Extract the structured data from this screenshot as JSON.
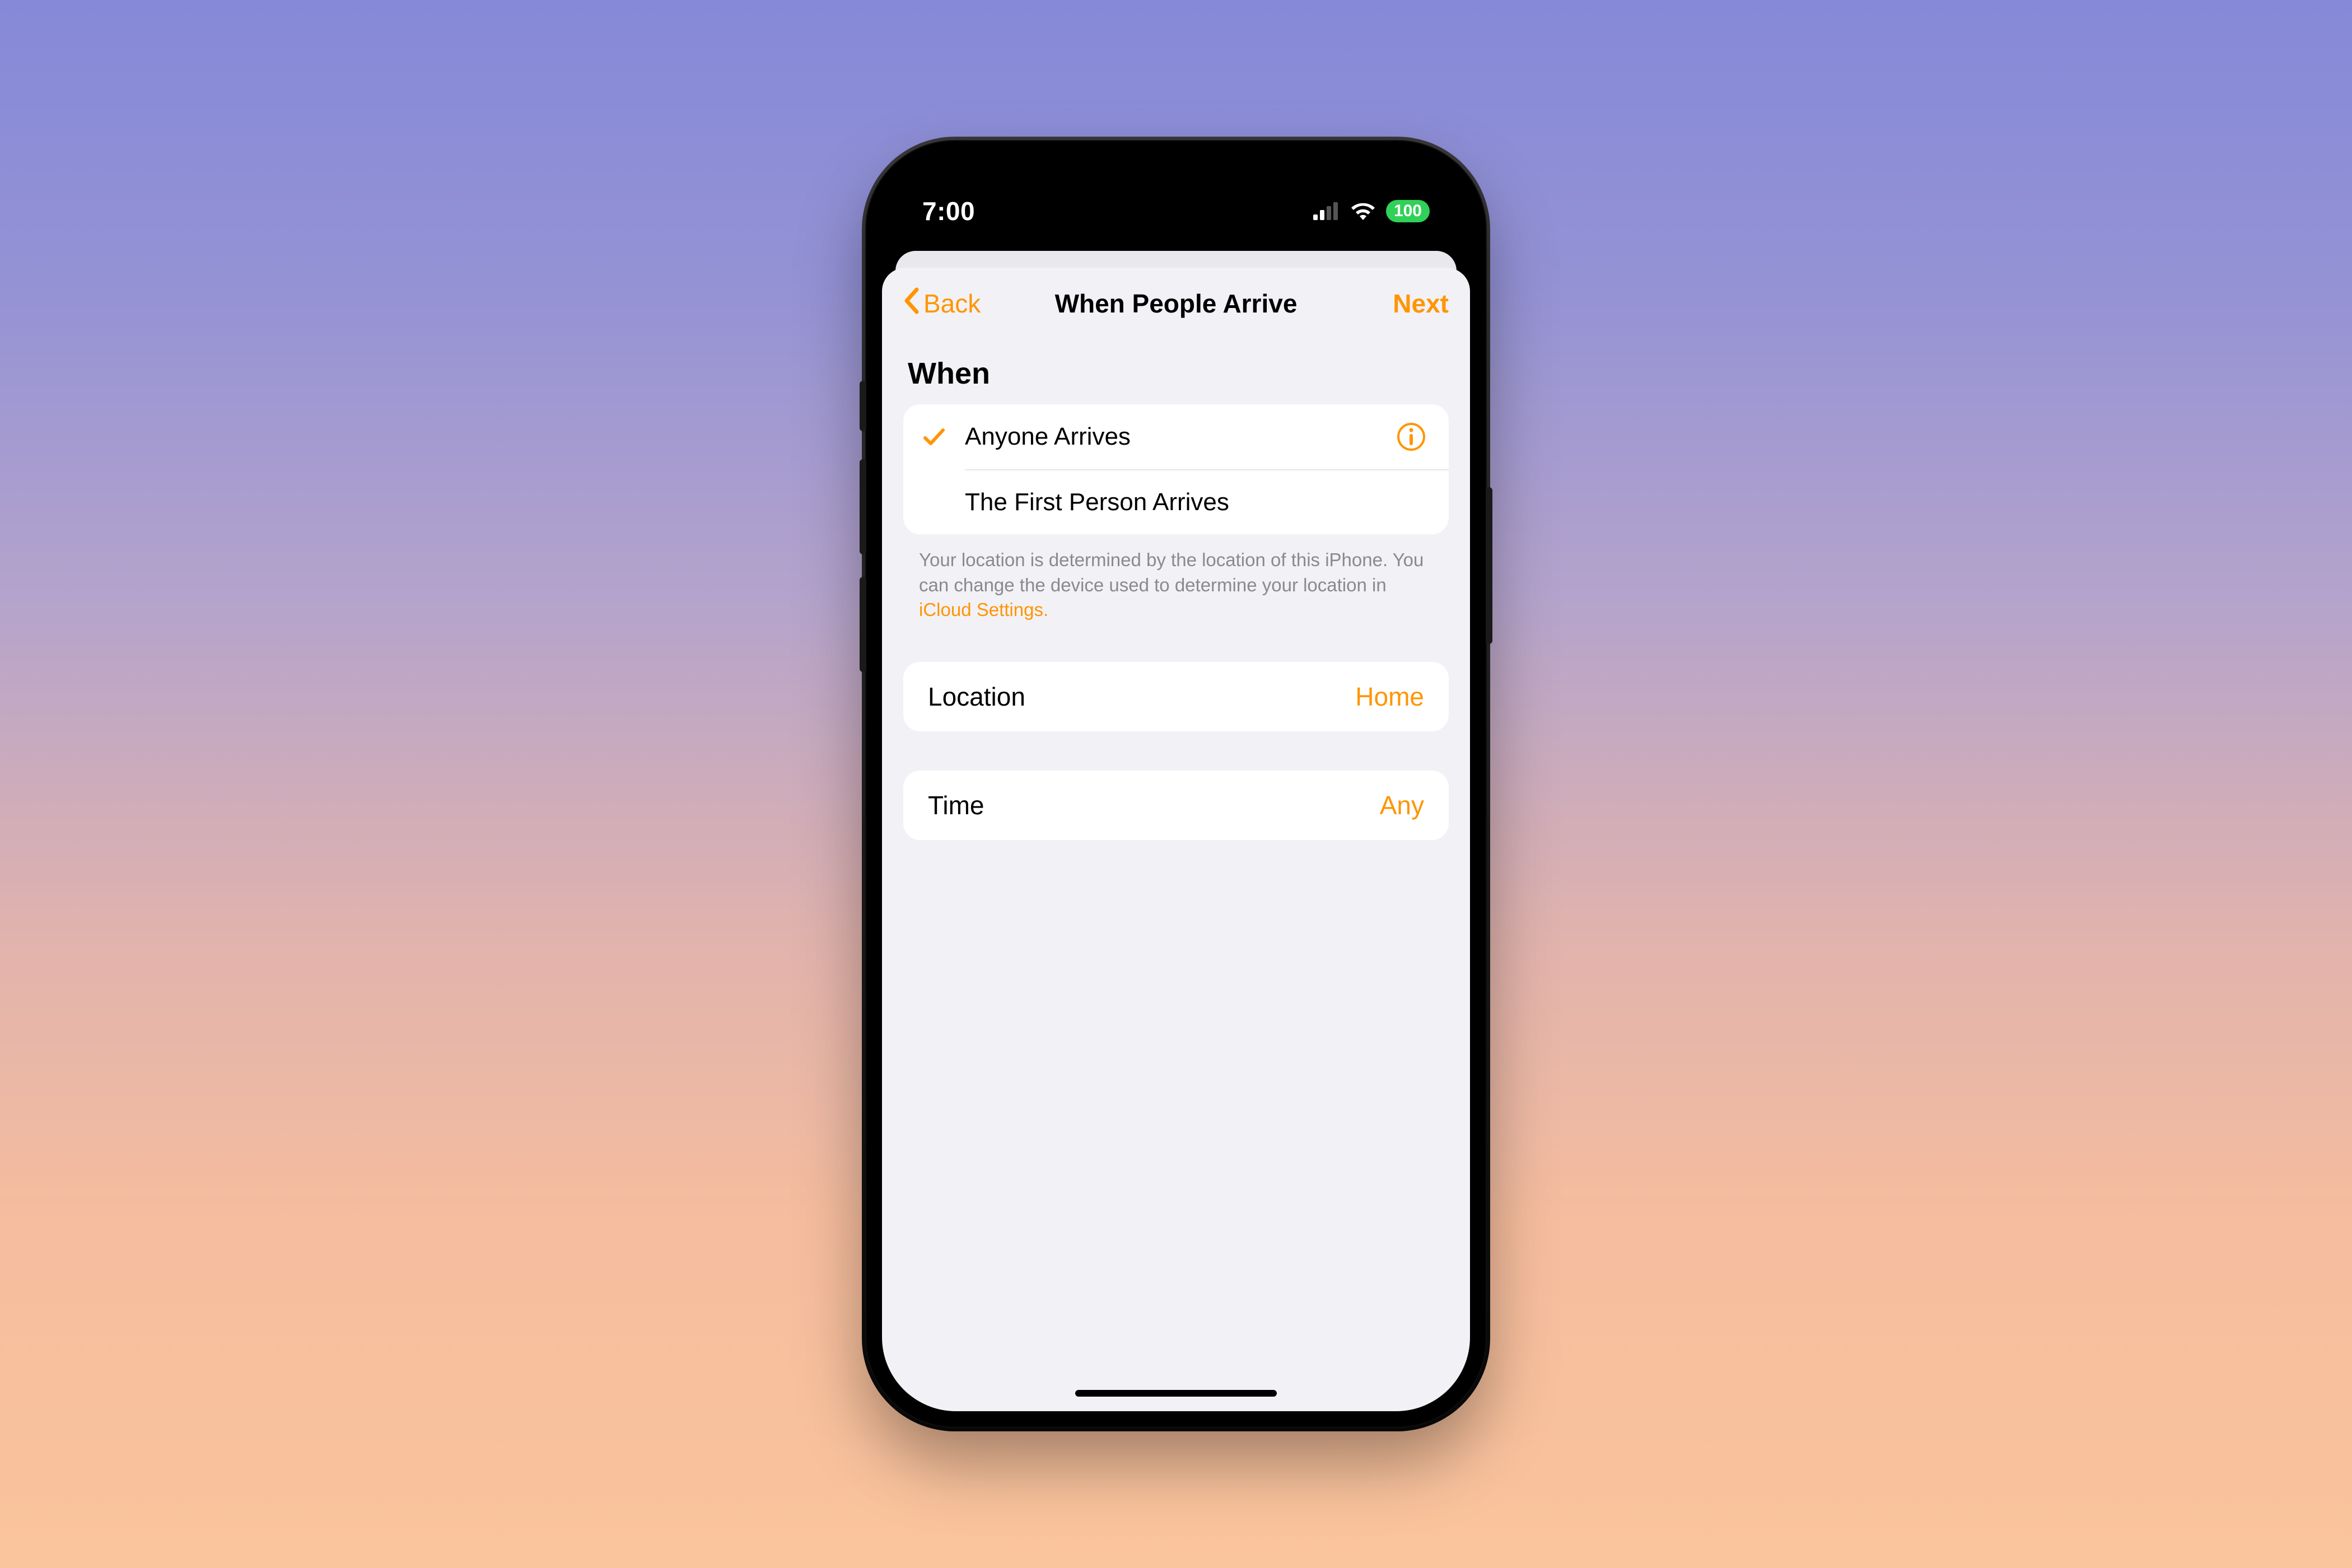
{
  "colors": {
    "accent": "#ff9500",
    "battery_green": "#30d158"
  },
  "statusbar": {
    "time": "7:00",
    "battery_text": "100"
  },
  "nav": {
    "back_label": "Back",
    "title": "When People Arrive",
    "next_label": "Next"
  },
  "when": {
    "header": "When",
    "options": [
      {
        "label": "Anyone Arrives",
        "selected": true,
        "has_info": true
      },
      {
        "label": "The First Person Arrives",
        "selected": false,
        "has_info": false
      }
    ],
    "footer_text": "Your location is determined by the location of this iPhone. You can change the device used to determine your location in ",
    "footer_link_text": "iCloud Settings."
  },
  "location": {
    "key": "Location",
    "value": "Home"
  },
  "time": {
    "key": "Time",
    "value": "Any"
  }
}
